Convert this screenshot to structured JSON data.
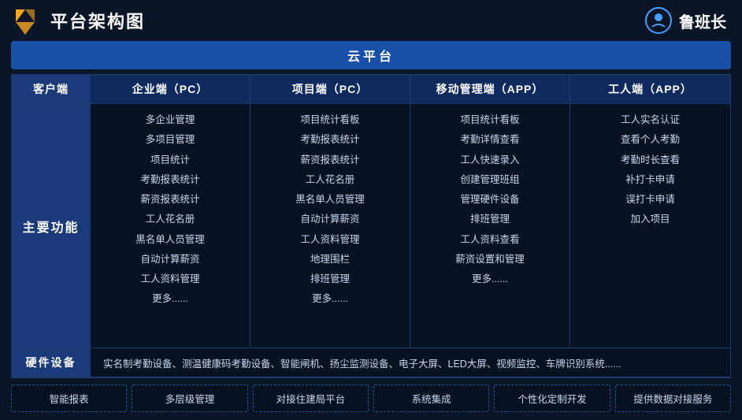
{
  "header": {
    "title": "平台架构图",
    "brand_name": "鲁班长"
  },
  "cloud_platform": {
    "label": "云平台"
  },
  "columns": {
    "client": "客户端",
    "enterprise_pc": "企业端（PC）",
    "project_pc": "项目端（PC）",
    "mobile_app": "移动管理端（APP）",
    "worker_app": "工人端（APP）"
  },
  "row_label_main": "主要功能",
  "row_label_hardware": "硬件设备",
  "enterprise_items": [
    "多企业管理",
    "多项目管理",
    "项目统计",
    "考勤报表统计",
    "薪资报表统计",
    "工人花名册",
    "黑名单人员管理",
    "自动计算薪资",
    "工人资料管理",
    "更多......"
  ],
  "project_items": [
    "项目统计看板",
    "考勤报表统计",
    "薪资报表统计",
    "工人花名册",
    "黑名单人员管理",
    "自动计算薪资",
    "工人资料管理",
    "地理围栏",
    "排班管理",
    "更多......"
  ],
  "mobile_items": [
    "项目统计看板",
    "考勤详情查看",
    "工人快速录入",
    "创建管理班组",
    "管理硬件设备",
    "排班管理",
    "工人资料查看",
    "薪资设置和管理",
    "更多......"
  ],
  "worker_items": [
    "工人实名认证",
    "查看个人考勤",
    "考勤时长查看",
    "补打卡申请",
    "误打卡申请",
    "加入项目"
  ],
  "hardware_content": "实名制考勤设备、测温健康码考勤设备、智能闸机、扬尘监测设备、电子大屏、LED大屏、视频监控、车牌识别系统......",
  "features": [
    "智能报表",
    "多层级管理",
    "对接住建局平台",
    "系统集成",
    "个性化定制开发",
    "提供数据对接服务"
  ]
}
